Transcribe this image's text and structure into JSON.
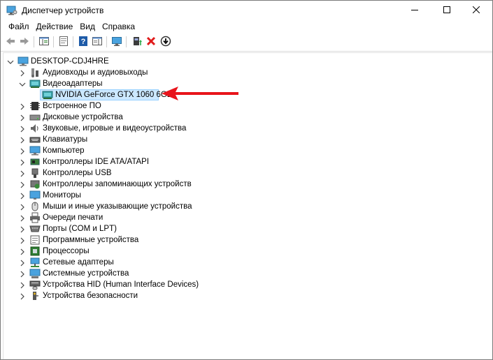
{
  "window": {
    "title": "Диспетчер устройств",
    "icon": "device-manager-icon"
  },
  "window_controls": {
    "minimize": "minimize-icon",
    "maximize": "maximize-icon",
    "close": "close-icon"
  },
  "menu": {
    "items": [
      "Файл",
      "Действие",
      "Вид",
      "Справка"
    ]
  },
  "toolbar": {
    "buttons": [
      "back-arrow-icon",
      "forward-arrow-icon",
      "show-hide-console-tree-icon",
      "properties-icon",
      "help-icon",
      "action-pane-icon",
      "scan-hardware-icon",
      "update-driver-icon",
      "uninstall-device-icon",
      "rollback-driver-icon"
    ]
  },
  "tree": {
    "root": "DESKTOP-CDJ4HRE",
    "categories": [
      {
        "label": "Аудиовходы и аудиовыходы",
        "expanded": false
      },
      {
        "label": "Видеоадаптеры",
        "expanded": true,
        "children": [
          "NVIDIA GeForce GTX 1060 6GB"
        ]
      },
      {
        "label": "Встроенное ПО",
        "expanded": false
      },
      {
        "label": "Дисковые устройства",
        "expanded": false
      },
      {
        "label": "Звуковые, игровые и видеоустройства",
        "expanded": false
      },
      {
        "label": "Клавиатуры",
        "expanded": false
      },
      {
        "label": "Компьютер",
        "expanded": false
      },
      {
        "label": "Контроллеры IDE ATA/ATAPI",
        "expanded": false
      },
      {
        "label": "Контроллеры USB",
        "expanded": false
      },
      {
        "label": "Контроллеры запоминающих устройств",
        "expanded": false
      },
      {
        "label": "Мониторы",
        "expanded": false
      },
      {
        "label": "Мыши и иные указывающие устройства",
        "expanded": false
      },
      {
        "label": "Очереди печати",
        "expanded": false
      },
      {
        "label": "Порты (COM и LPT)",
        "expanded": false
      },
      {
        "label": "Программные устройства",
        "expanded": false
      },
      {
        "label": "Процессоры",
        "expanded": false
      },
      {
        "label": "Сетевые адаптеры",
        "expanded": false
      },
      {
        "label": "Системные устройства",
        "expanded": false
      },
      {
        "label": "Устройства HID (Human Interface Devices)",
        "expanded": false
      },
      {
        "label": "Устройства безопасности",
        "expanded": false
      }
    ],
    "selected": "NVIDIA GeForce GTX 1060 6GB"
  },
  "colors": {
    "selection_bg": "#cce8ff",
    "selection_border": "#99d1ff",
    "annotation_arrow": "#e8141b"
  }
}
